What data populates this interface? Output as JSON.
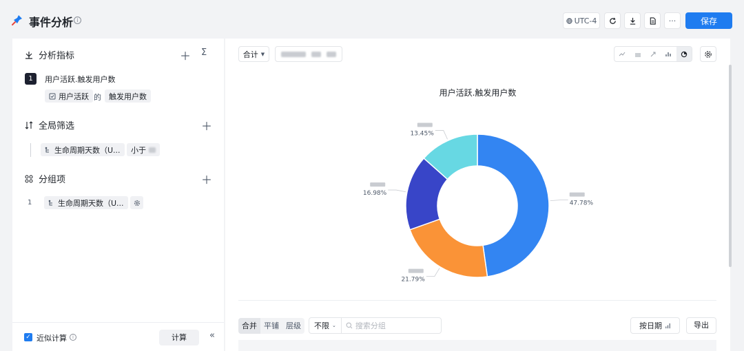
{
  "header": {
    "title": "事件分析",
    "timezone": "UTC-4",
    "save_label": "保存",
    "more_label": "···"
  },
  "sidebar": {
    "metrics": {
      "title": "分析指标",
      "index": "1",
      "name": "用户活跃.触发用户数",
      "event_chip": "用户活跃",
      "connector": "的",
      "measure_chip": "触发用户数"
    },
    "filter": {
      "title": "全局筛选",
      "property_chip": "生命周期天数（U...",
      "operator_chip": "小于"
    },
    "grouping": {
      "title": "分组项",
      "index": "1",
      "property_chip": "生命周期天数（U..."
    },
    "footer": {
      "approx_label": "近似计算",
      "calc_label": "计算",
      "collapse_label": "«"
    }
  },
  "toolbar": {
    "aggregate_label": "合计"
  },
  "chart_data": {
    "type": "pie",
    "title": "用户活跃.触发用户数",
    "donut": true,
    "slices": [
      {
        "label": "47.78%",
        "value": 47.78,
        "color": "#3385f2"
      },
      {
        "label": "21.79%",
        "value": 21.79,
        "color": "#fa9337"
      },
      {
        "label": "16.98%",
        "value": 16.98,
        "color": "#3845c8"
      },
      {
        "label": "13.45%",
        "value": 13.45,
        "color": "#67d8e3"
      }
    ]
  },
  "bottom": {
    "seg_merge": "合并",
    "seg_tile": "平铺",
    "seg_level": "层级",
    "limit_label": "不限",
    "search_placeholder": "搜索分组",
    "by_date_label": "按日期",
    "export_label": "导出"
  }
}
